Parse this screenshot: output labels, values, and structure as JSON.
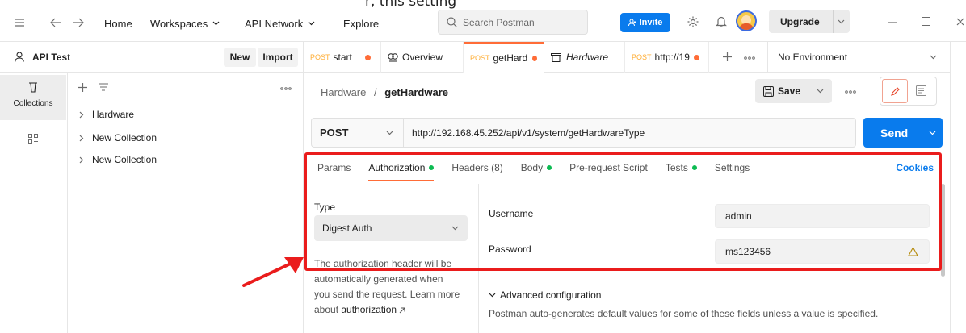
{
  "overlay_text": "r, this setting",
  "header": {
    "nav": {
      "home": "Home",
      "workspaces": "Workspaces",
      "api_network": "API Network",
      "explore": "Explore"
    },
    "search_placeholder": "Search Postman",
    "invite_label": "Invite",
    "upgrade_label": "Upgrade"
  },
  "workspace": {
    "name": "API Test",
    "new_label": "New",
    "import_label": "Import"
  },
  "sidebar": {
    "rail_collections_label": "Collections",
    "collections": [
      {
        "label": "Hardware"
      },
      {
        "label": "New Collection"
      },
      {
        "label": "New Collection"
      }
    ]
  },
  "tabs": [
    {
      "method": "POST",
      "label": "start"
    },
    {
      "label": "Overview"
    },
    {
      "method": "POST",
      "label": "getHard"
    },
    {
      "label": "Hardware"
    },
    {
      "method": "POST",
      "label": "http://19"
    }
  ],
  "environment": "No Environment",
  "request": {
    "breadcrumb_parent": "Hardware",
    "breadcrumb_separator": "/",
    "breadcrumb_current": "getHardware",
    "save_label": "Save",
    "method": "POST",
    "url": "http://192.168.45.252/api/v1/system/getHardwareType",
    "send_label": "Send"
  },
  "request_tabs": {
    "params": "Params",
    "authorization": "Authorization",
    "headers": "Headers (8)",
    "body": "Body",
    "pre_request": "Pre-request Script",
    "tests": "Tests",
    "settings": "Settings",
    "cookies": "Cookies"
  },
  "auth": {
    "type_label": "Type",
    "type_value": "Digest Auth",
    "help_lines": [
      "The authorization header will be",
      "automatically generated when",
      "you send the request. Learn more"
    ],
    "help_about": "about",
    "help_link": "authorization",
    "username_label": "Username",
    "username_value": "admin",
    "password_label": "Password",
    "password_value": "ms123456",
    "advanced_label": "Advanced configuration",
    "advanced_desc": "Postman auto-generates default values for some of these fields unless a value is specified."
  }
}
